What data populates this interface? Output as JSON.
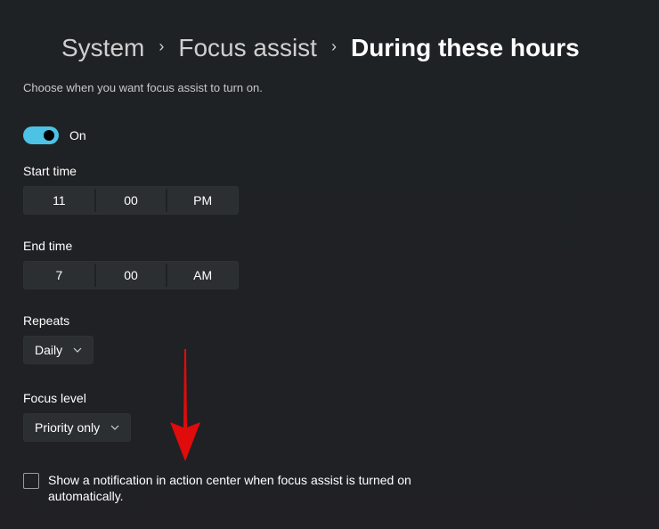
{
  "breadcrumb": {
    "items": [
      "System",
      "Focus assist",
      "During these hours"
    ],
    "separator": "›"
  },
  "description": "Choose when you want focus assist to turn on.",
  "toggle": {
    "state": "on",
    "label": "On",
    "accent_color": "#4cc2e4"
  },
  "start_time": {
    "label": "Start time",
    "hour": "11",
    "minute": "00",
    "period": "PM"
  },
  "end_time": {
    "label": "End time",
    "hour": "7",
    "minute": "00",
    "period": "AM"
  },
  "repeats": {
    "label": "Repeats",
    "selected": "Daily"
  },
  "focus_level": {
    "label": "Focus level",
    "selected": "Priority only"
  },
  "notification_checkbox": {
    "checked": false,
    "label": "Show a notification in action center when focus assist is turned on automatically."
  },
  "annotation": {
    "type": "arrow-down",
    "color": "#e00b0b"
  }
}
